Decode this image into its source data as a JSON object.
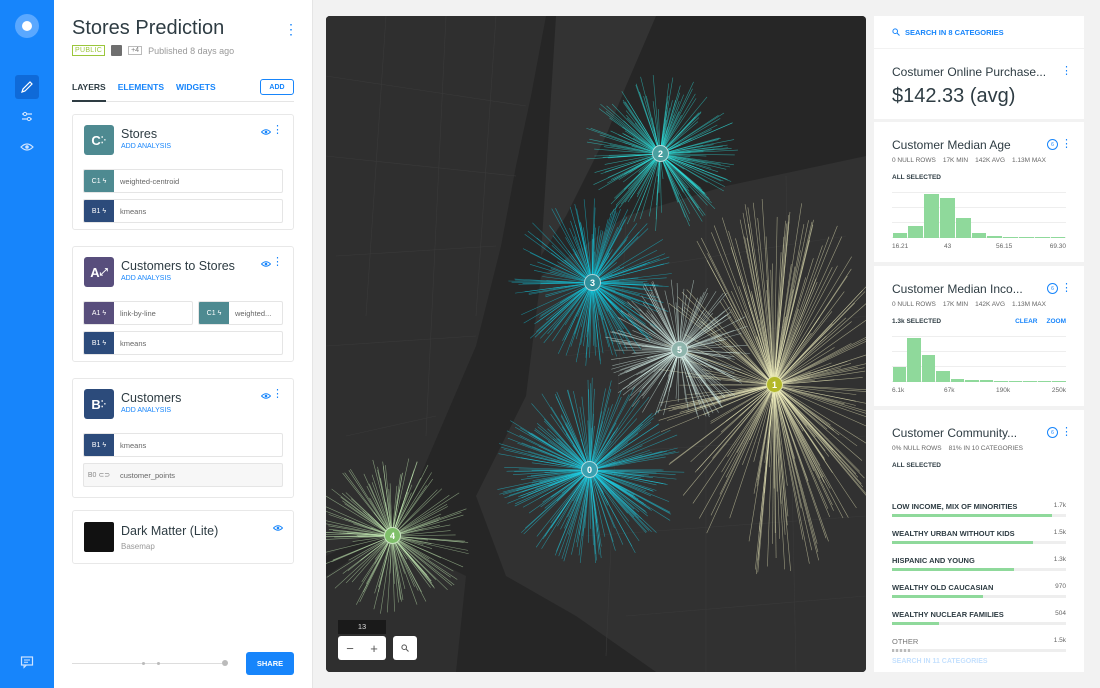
{
  "editor": {
    "title": "Stores Prediction",
    "visibility": "PUBLIC",
    "collaborators": "+4",
    "published": "Published 8 days ago",
    "tabs": [
      "LAYERS",
      "ELEMENTS",
      "WIDGETS"
    ],
    "add_label": "ADD",
    "share_label": "SHARE"
  },
  "layers": [
    {
      "letter": "C",
      "name": "Stores",
      "add_analysis": "ADD ANALYSIS",
      "color": "#4e8a91",
      "nodes": [
        {
          "id": "C1",
          "label": "weighted-centroid",
          "color": "#4e8a91"
        },
        {
          "id": "B1",
          "label": "kmeans",
          "color": "#2c4b7b"
        }
      ]
    },
    {
      "letter": "A",
      "name": "Customers to Stores",
      "add_analysis": "ADD ANALYSIS",
      "color": "#584e7c",
      "nodes": [
        {
          "id": "A1",
          "label": "link-by-line",
          "color": "#584e7c"
        },
        {
          "id": "C1",
          "label": "weighted...",
          "color": "#4e8a91"
        },
        {
          "id": "B1",
          "label": "kmeans",
          "color": "#2c4b7b"
        }
      ]
    },
    {
      "letter": "B",
      "name": "Customers",
      "add_analysis": "ADD ANALYSIS",
      "color": "#2c4b7b",
      "nodes": [
        {
          "id": "B1",
          "label": "kmeans",
          "color": "#2c4b7b"
        },
        {
          "id": "B0",
          "label": "customer_points",
          "color": "#f7f7f7"
        }
      ]
    }
  ],
  "basemap": {
    "name": "Dark Matter (Lite)",
    "type": "Basemap"
  },
  "map": {
    "zoom": "13",
    "clusters": [
      {
        "label": "0",
        "color": "#3aa0b0"
      },
      {
        "label": "1",
        "color": "#b3b82a"
      },
      {
        "label": "2",
        "color": "#4aa0a0"
      },
      {
        "label": "3",
        "color": "#2f8f9b"
      },
      {
        "label": "4",
        "color": "#7fbf6a"
      },
      {
        "label": "5",
        "color": "#8fb5ad"
      }
    ]
  },
  "widgets": {
    "search_label": "SEARCH IN 8 CATEGORIES",
    "formula": {
      "title": "Costumer Online Purchase...",
      "value": "$142.33 (avg)"
    },
    "age": {
      "title": "Customer Median Age",
      "stats": [
        "0 NULL ROWS",
        "17K MIN",
        "142K AVG",
        "1.13M MAX"
      ],
      "selection": "ALL SELECTED",
      "ticks": [
        "16.21",
        "43",
        "56.15",
        "69.30"
      ],
      "bins": [
        0.12,
        0.28,
        1.0,
        0.92,
        0.45,
        0.12,
        0.05,
        0.02,
        0.02,
        0.01,
        0.01
      ]
    },
    "income": {
      "title": "Customer Median Inco...",
      "stats": [
        "0 NULL ROWS",
        "17K MIN",
        "142K AVG",
        "1.13M MAX"
      ],
      "selection": "1.3k SELECTED",
      "clear": "CLEAR",
      "zoom": "ZOOM",
      "ticks": [
        "6.1k",
        "67k",
        "190k",
        "250k"
      ],
      "bins": [
        0.35,
        1.0,
        0.62,
        0.25,
        0.07,
        0.05,
        0.04,
        0.03,
        0.03,
        0.02,
        0.02,
        0.02
      ]
    },
    "community": {
      "title": "Customer Community...",
      "stats": [
        "0% NULL ROWS",
        "81% IN 10 CATEGORIES"
      ],
      "selection": "ALL SELECTED",
      "categories": [
        {
          "name": "LOW INCOME, MIX OF MINORITIES",
          "count": "1.7k",
          "value": 1700
        },
        {
          "name": "WEALTHY URBAN WITHOUT KIDS",
          "count": "1.5k",
          "value": 1500
        },
        {
          "name": "HISPANIC AND YOUNG",
          "count": "1.3k",
          "value": 1300
        },
        {
          "name": "WEALTHY OLD CAUCASIAN",
          "count": "970",
          "value": 970
        },
        {
          "name": "WEALTHY NUCLEAR FAMILIES",
          "count": "504",
          "value": 504
        },
        {
          "name": "OTHER",
          "count": "1.5k",
          "value": 1500
        }
      ],
      "footer": "SEARCH IN 11 CATEGORIES"
    }
  }
}
